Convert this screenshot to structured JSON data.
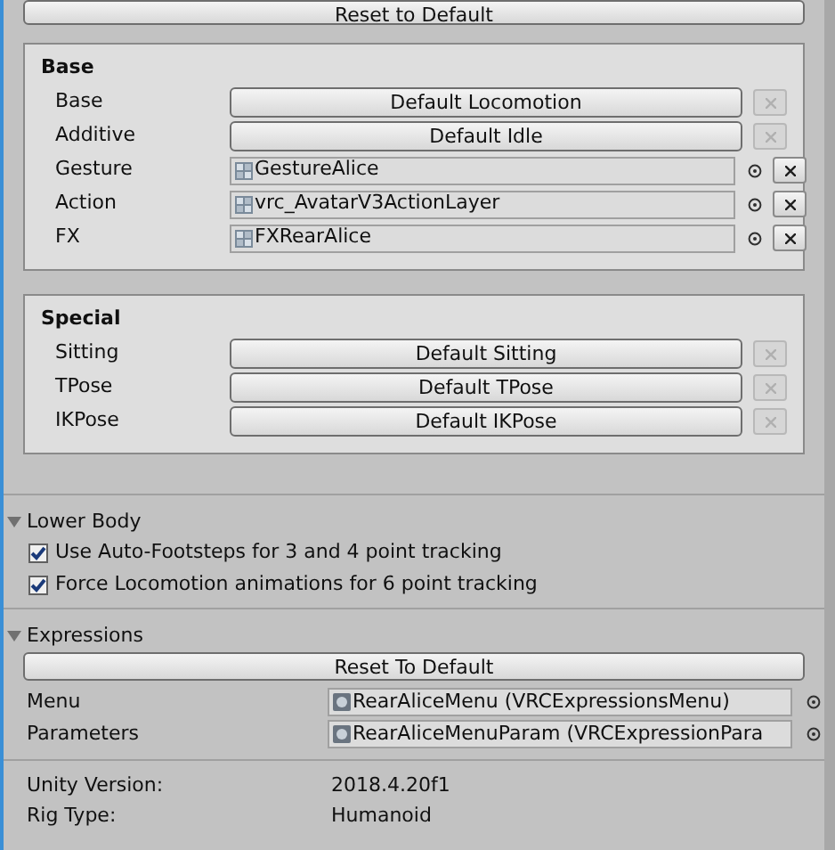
{
  "top_button": "Reset to Default",
  "panels": [
    {
      "title": "Base",
      "rows": [
        {
          "label": "Base",
          "kind": "default",
          "value": "Default Locomotion",
          "clear_disabled": true
        },
        {
          "label": "Additive",
          "kind": "default",
          "value": "Default Idle",
          "clear_disabled": true
        },
        {
          "label": "Gesture",
          "kind": "asset",
          "value": "GestureAlice",
          "clear_disabled": false
        },
        {
          "label": "Action",
          "kind": "asset",
          "value": "vrc_AvatarV3ActionLayer",
          "clear_disabled": false
        },
        {
          "label": "FX",
          "kind": "asset",
          "value": "FXRearAlice",
          "clear_disabled": false
        }
      ]
    },
    {
      "title": "Special",
      "rows": [
        {
          "label": "Sitting",
          "kind": "default",
          "value": "Default Sitting",
          "clear_disabled": true
        },
        {
          "label": "TPose",
          "kind": "default",
          "value": "Default TPose",
          "clear_disabled": true
        },
        {
          "label": "IKPose",
          "kind": "default",
          "value": "Default IKPose",
          "clear_disabled": true
        }
      ]
    }
  ],
  "lower_body": {
    "title": "Lower Body",
    "expanded": true,
    "options": [
      {
        "label": "Use Auto-Footsteps for 3 and 4 point tracking",
        "checked": true
      },
      {
        "label": "Force Locomotion animations for 6 point tracking",
        "checked": true
      }
    ]
  },
  "expressions": {
    "title": "Expressions",
    "expanded": true,
    "reset_button": "Reset To Default",
    "fields": [
      {
        "label": "Menu",
        "value": "RearAliceMenu (VRCExpressionsMenu)"
      },
      {
        "label": "Parameters",
        "value": "RearAliceMenuParam (VRCExpressionPara"
      }
    ]
  },
  "info": [
    {
      "label": "Unity Version:",
      "value": "2018.4.20f1"
    },
    {
      "label": "Rig Type:",
      "value": "Humanoid"
    }
  ]
}
